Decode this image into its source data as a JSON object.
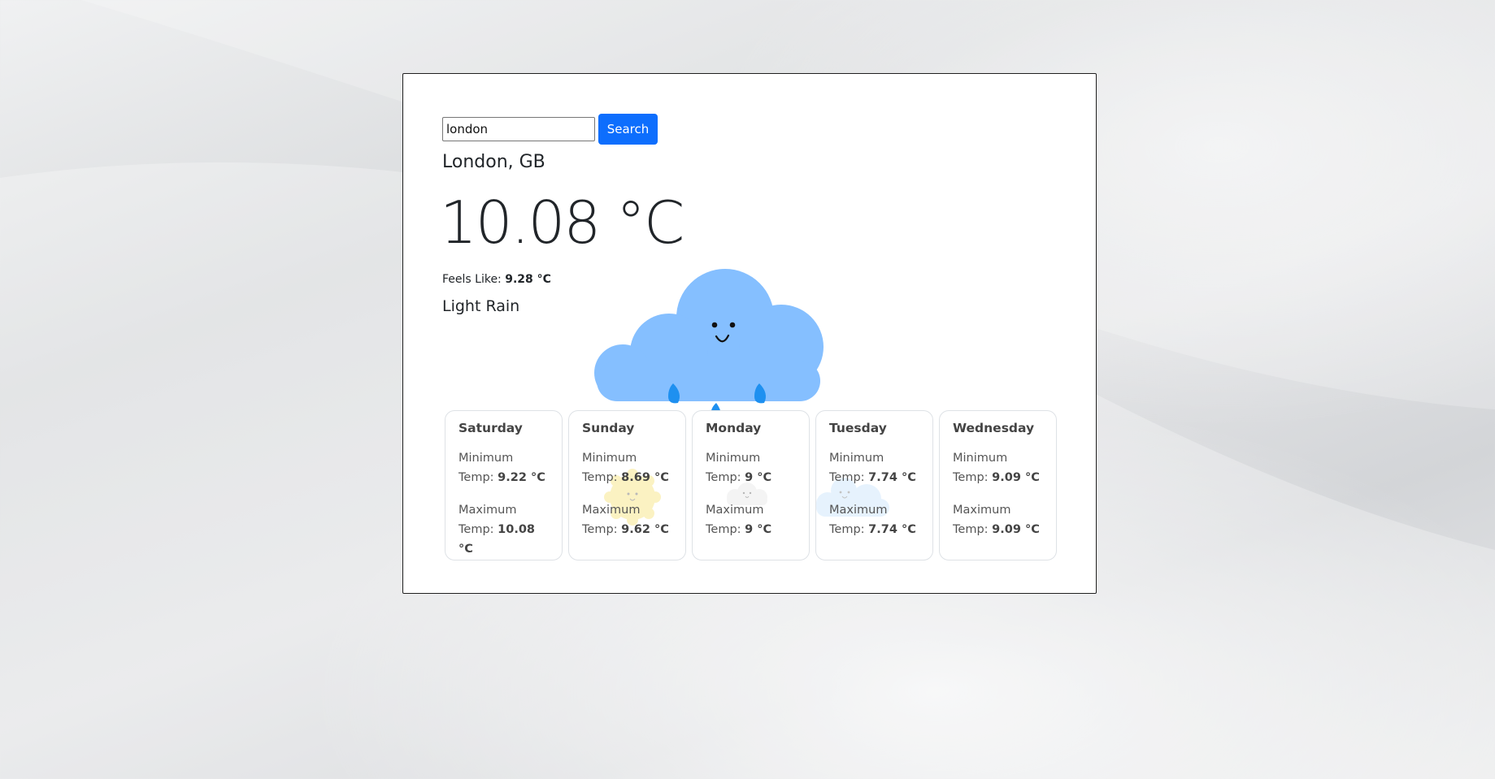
{
  "search": {
    "value": "london",
    "button_label": "Search"
  },
  "current": {
    "location": "London, GB",
    "temperature": "10.08 °C",
    "feels_like_label": "Feels Like:",
    "feels_like_value": "9.28 °C",
    "description": "Light Rain",
    "icon": "cloud-rain-icon"
  },
  "forecast": [
    {
      "day": "Saturday",
      "min_label_1": "Minimum",
      "min_label_2": "Temp:",
      "min": "9.22 °C",
      "max_label_1": "Maximum",
      "max_label_2": "Temp:",
      "max": "10.08 °C",
      "icon": "none"
    },
    {
      "day": "Sunday",
      "min_label_1": "Minimum",
      "min_label_2": "Temp:",
      "min": "8.69 °C",
      "max_label_1": "Maximum",
      "max_label_2": "Temp:",
      "max": "9.62 °C",
      "icon": "sun-icon"
    },
    {
      "day": "Monday",
      "min_label_1": "Minimum",
      "min_label_2": "Temp:",
      "min": "9 °C",
      "max_label_1": "Maximum",
      "max_label_2": "Temp:",
      "max": "9 °C",
      "icon": "white-cloud-icon"
    },
    {
      "day": "Tuesday",
      "min_label_1": "Minimum",
      "min_label_2": "Temp:",
      "min": "7.74 °C",
      "max_label_1": "Maximum",
      "max_label_2": "Temp:",
      "max": "7.74 °C",
      "icon": "cloud-icon"
    },
    {
      "day": "Wednesday",
      "min_label_1": "Minimum",
      "min_label_2": "Temp:",
      "min": "9.09 °C",
      "max_label_1": "Maximum",
      "max_label_2": "Temp:",
      "max": "9.09 °C",
      "icon": "none"
    }
  ],
  "colors": {
    "accent": "#0d6efd",
    "cloud": "#85bfff",
    "raindrop": "#1e90f0",
    "sun": "#f7e37a"
  }
}
